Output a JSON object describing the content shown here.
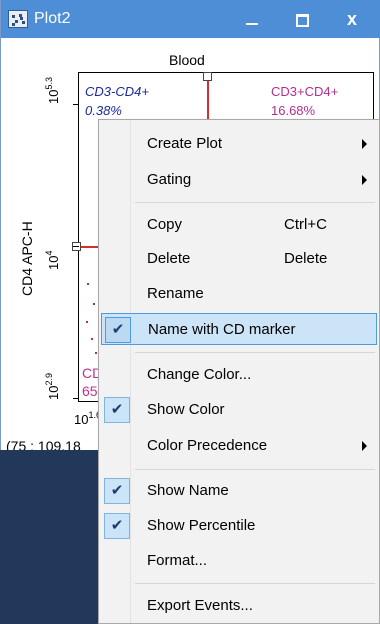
{
  "window": {
    "title": "Plot2",
    "controls": [
      "minimize",
      "maximize",
      "close"
    ],
    "close_glyph": "x"
  },
  "plot": {
    "title": "Blood",
    "y_axis_label": "CD4 APC-H",
    "y_ticks": {
      "top_base": "10",
      "top_exp": "5.3",
      "mid_base": "10",
      "mid_exp": "4",
      "bot_base": "10",
      "bot_exp": "2.9"
    },
    "x_ticks": {
      "left_base": "10",
      "left_exp": "1.6"
    },
    "quadrants": {
      "upper_left": {
        "name": "CD3-CD4+",
        "percent": "0.38%"
      },
      "upper_right": {
        "name": "CD3+CD4+",
        "percent": "16.68%"
      },
      "lower_left": {
        "name": "CD",
        "percent": "65"
      }
    },
    "cursor_coords": "(75 : 109,18"
  },
  "context_menu": {
    "items": [
      {
        "label": "Create Plot",
        "submenu": true
      },
      {
        "label": "Gating",
        "submenu": true
      },
      {
        "label": "Copy",
        "shortcut": "Ctrl+C"
      },
      {
        "label": "Delete",
        "shortcut": "Delete"
      },
      {
        "label": "Rename"
      },
      {
        "label": "Name with CD marker",
        "checked": true,
        "highlighted": true
      },
      {
        "label": "Change Color..."
      },
      {
        "label": "Show Color",
        "checked": true
      },
      {
        "label": "Color Precedence",
        "submenu": true
      },
      {
        "label": "Show Name",
        "checked": true
      },
      {
        "label": "Show Percentile",
        "checked": true
      },
      {
        "label": "Format..."
      },
      {
        "label": "Export Events..."
      }
    ]
  },
  "colors": {
    "titlebar": "#4d8ed6",
    "highlight": "#cce4f7",
    "gate_line": "#d32f2f",
    "quadrant_blue": "#1a2a9a",
    "quadrant_magenta": "#b0308f"
  }
}
